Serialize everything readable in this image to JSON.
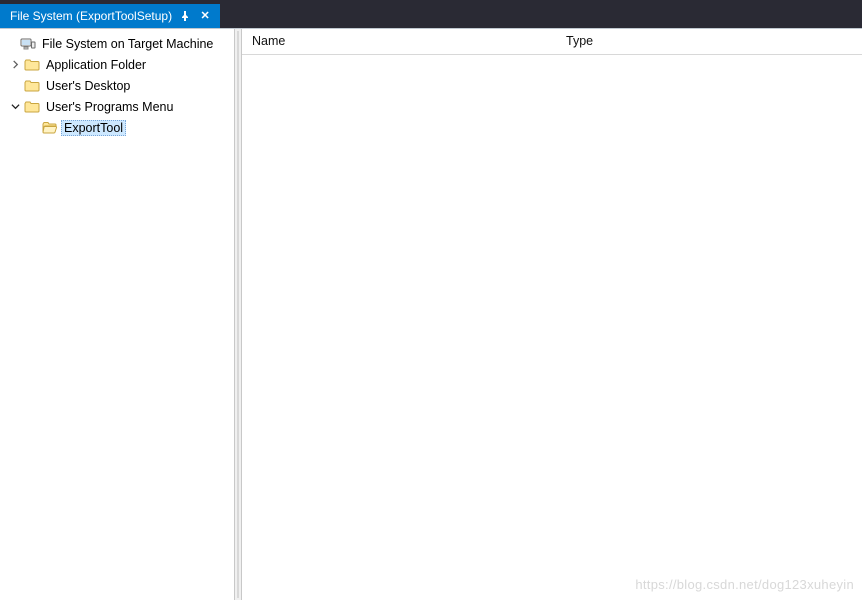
{
  "window": {
    "tab_title": "File System (ExportToolSetup)"
  },
  "tree": {
    "root": {
      "label": "File System on Target Machine",
      "children": [
        {
          "id": "app_folder",
          "label": "Application Folder",
          "expandable": true,
          "expanded": false,
          "children": []
        },
        {
          "id": "user_desktop",
          "label": "User's Desktop",
          "expandable": false,
          "expanded": false,
          "children": []
        },
        {
          "id": "user_programs",
          "label": "User's Programs Menu",
          "expandable": true,
          "expanded": true,
          "children": [
            {
              "id": "export_tool",
              "label": "ExportTool",
              "expandable": false,
              "selected": true,
              "open": true
            }
          ]
        }
      ]
    }
  },
  "list": {
    "columns": {
      "name": "Name",
      "type": "Type"
    },
    "rows": []
  },
  "watermark": "https://blog.csdn.net/dog123xuheyin"
}
